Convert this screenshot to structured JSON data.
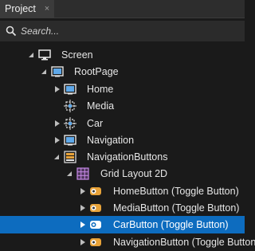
{
  "panel": {
    "tab_label": "Project",
    "tab_close": "×"
  },
  "search": {
    "placeholder": "Search..."
  },
  "tree": {
    "items": [
      {
        "label": "Screen",
        "icon": "screen-icon",
        "expanded": true
      },
      {
        "label": "RootPage",
        "icon": "page-icon",
        "expanded": true
      },
      {
        "label": "Home",
        "icon": "page-icon",
        "expanded": false
      },
      {
        "label": "Media",
        "icon": "empty-node-icon",
        "expanded": null
      },
      {
        "label": "Car",
        "icon": "empty-node-icon",
        "expanded": false
      },
      {
        "label": "Navigation",
        "icon": "page-icon",
        "expanded": false
      },
      {
        "label": "NavigationButtons",
        "icon": "stack-layout-icon",
        "expanded": true
      },
      {
        "label": "Grid Layout 2D",
        "icon": "grid-layout-icon",
        "expanded": true
      },
      {
        "label": "HomeButton (Toggle Button)",
        "icon": "toggle-button-icon",
        "expanded": false
      },
      {
        "label": "MediaButton (Toggle Button)",
        "icon": "toggle-button-icon",
        "expanded": false
      },
      {
        "label": "CarButton (Toggle Button)",
        "icon": "toggle-button-icon",
        "expanded": false,
        "selected": true
      },
      {
        "label": "NavigationButton (Toggle Button)",
        "icon": "toggle-button-icon",
        "expanded": false
      }
    ]
  },
  "colors": {
    "selection": "#0d6cbf",
    "background": "#1a1a1a",
    "toggle_icon": "#e8a33a"
  }
}
